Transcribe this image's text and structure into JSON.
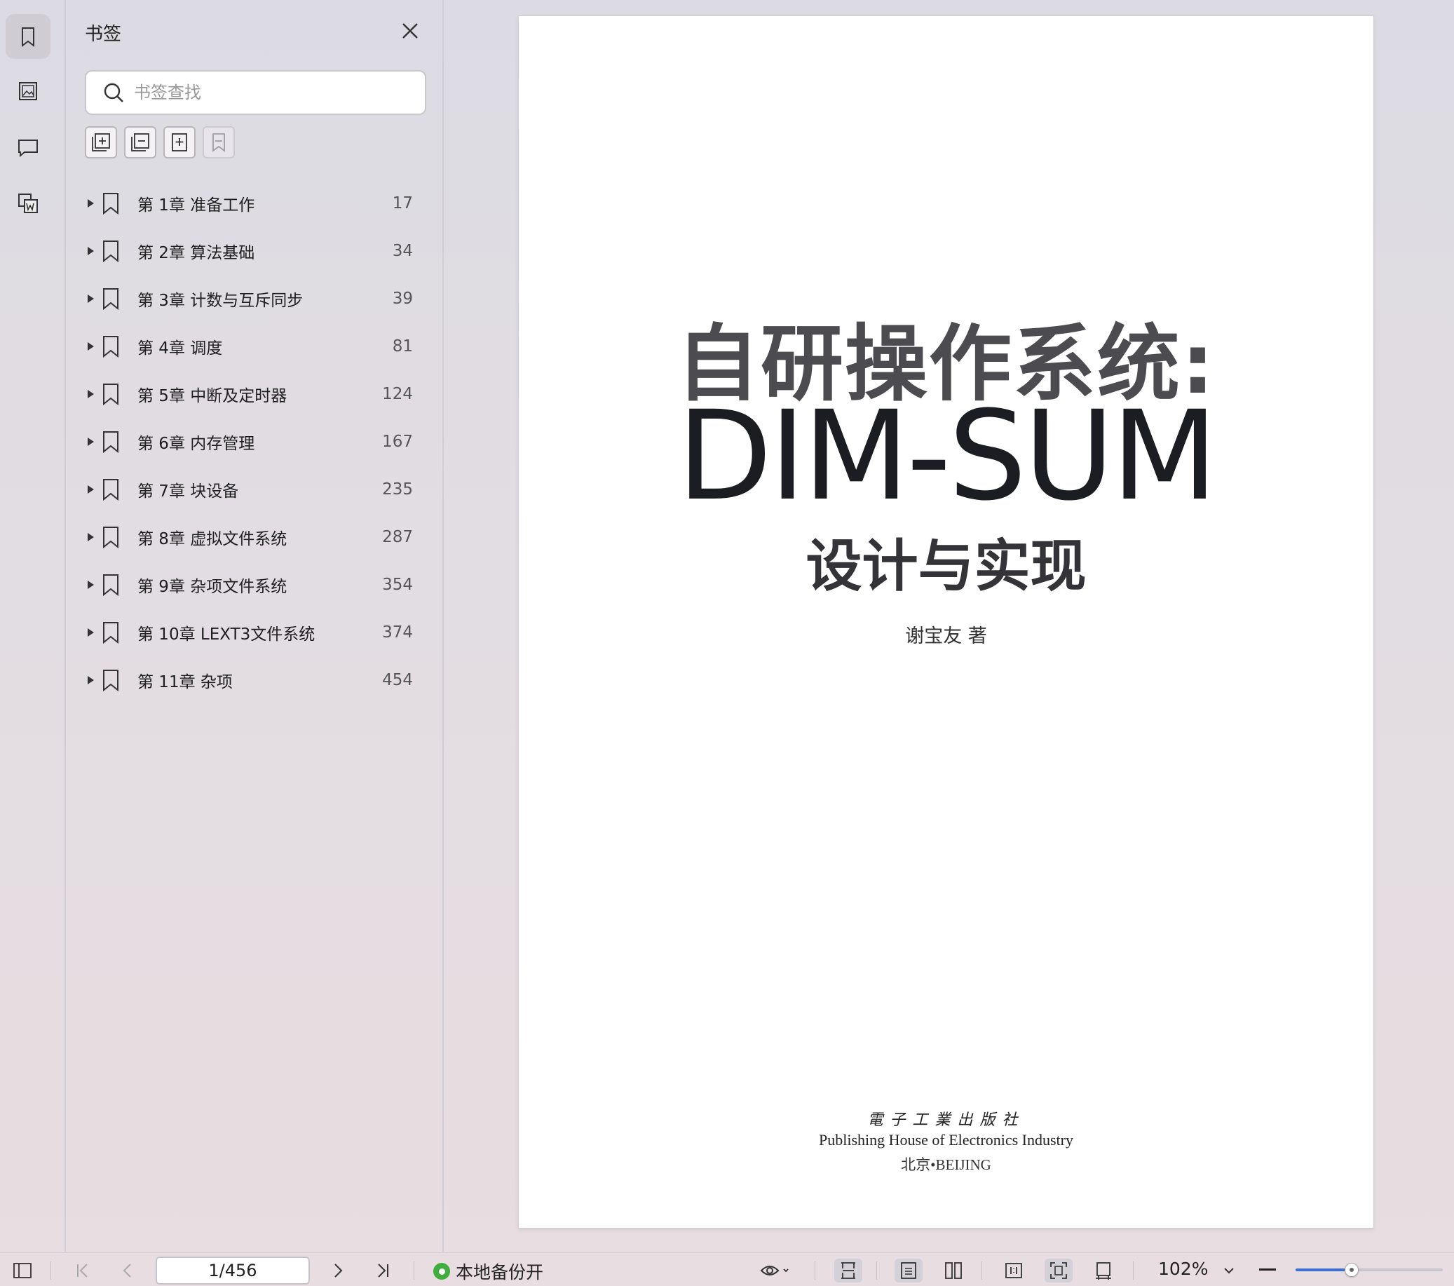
{
  "sidebar_panel": {
    "title": "书签",
    "search_placeholder": "书签查找",
    "items": [
      {
        "label": "第 1章 准备工作",
        "page": "17"
      },
      {
        "label": "第 2章 算法基础",
        "page": "34"
      },
      {
        "label": "第 3章 计数与互斥同步",
        "page": "39"
      },
      {
        "label": "第 4章 调度",
        "page": "81"
      },
      {
        "label": "第 5章 中断及定时器",
        "page": "124"
      },
      {
        "label": "第 6章 内存管理",
        "page": "167"
      },
      {
        "label": "第 7章 块设备",
        "page": "235"
      },
      {
        "label": "第 8章 虚拟文件系统",
        "page": "287"
      },
      {
        "label": "第 9章 杂项文件系统",
        "page": "354"
      },
      {
        "label": "第 10章 LEXT3文件系统",
        "page": "374"
      },
      {
        "label": "第 11章 杂项",
        "page": "454"
      }
    ]
  },
  "document": {
    "title_line1": "自研操作系统:",
    "title_line2": "DIM-SUM",
    "title_line3": "设计与实现",
    "author": "谢宝友 著",
    "publisher_cn": "電子工業出版社",
    "publisher_en": "Publishing House of Electronics Industry",
    "city": "北京•BEIJING"
  },
  "statusbar": {
    "page_indicator": "1/456",
    "backup_label": "本地备份开",
    "zoom_label": "102%",
    "zoom_level_fraction": 0.38
  },
  "colors": {
    "accent": "#3c6fd8",
    "backup_dot": "#3fae3f"
  }
}
